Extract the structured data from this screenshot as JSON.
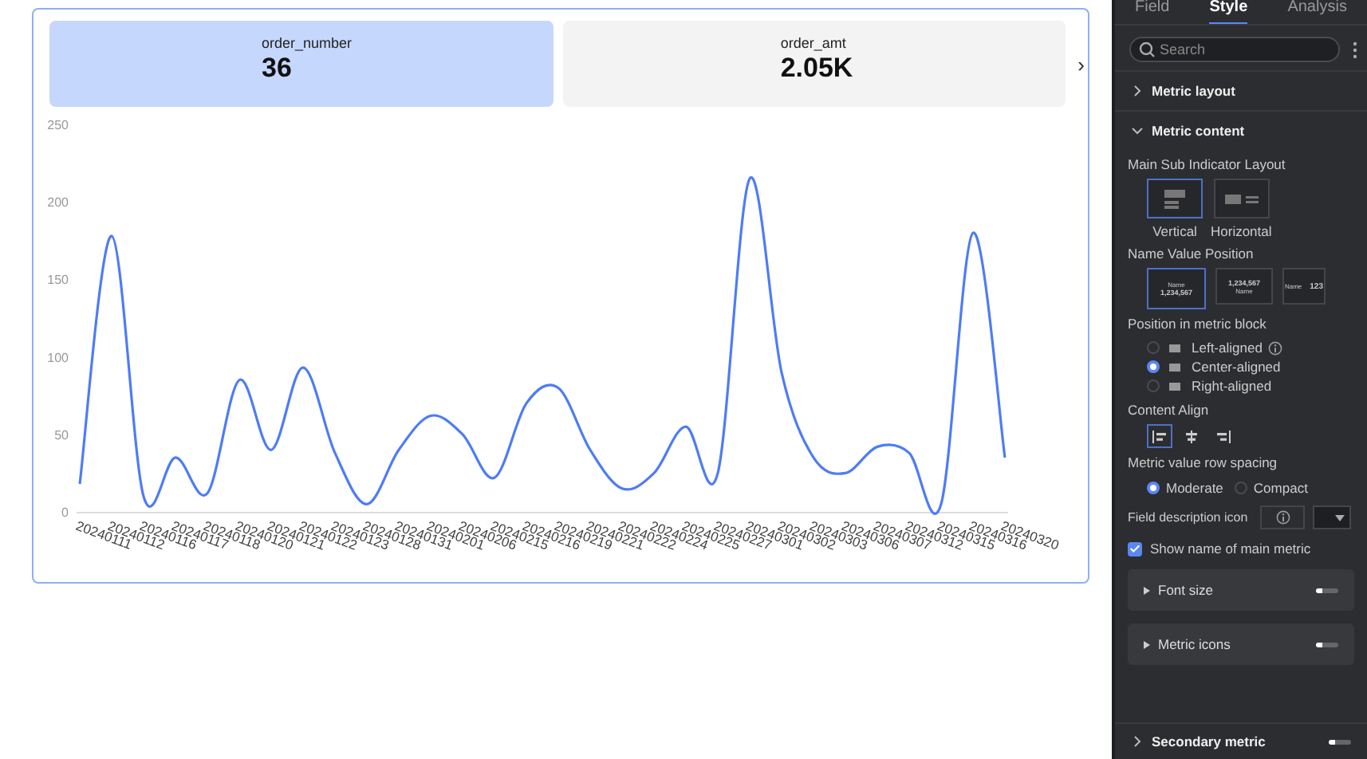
{
  "metric_cards": [
    {
      "name": "order_number",
      "value": "36",
      "selected": true
    },
    {
      "name": "order_amt",
      "value": "2.05K",
      "selected": false
    }
  ],
  "next_arrow": "›",
  "chart_data": {
    "type": "line",
    "categories": [
      "20240111",
      "20240112",
      "20240116",
      "20240117",
      "20240118",
      "20240120",
      "20240121",
      "20240122",
      "20240123",
      "20240128",
      "20240131",
      "20240201",
      "20240206",
      "20240215",
      "20240216",
      "20240219",
      "20240221",
      "20240222",
      "20240224",
      "20240225",
      "20240227",
      "20240301",
      "20240302",
      "20240303",
      "20240306",
      "20240307",
      "20240312",
      "20240315",
      "20240316",
      "20240320"
    ],
    "values": [
      18,
      178,
      10,
      35,
      12,
      85,
      40,
      93,
      38,
      5,
      40,
      62,
      50,
      22,
      70,
      80,
      40,
      15,
      25,
      55,
      25,
      215,
      90,
      35,
      25,
      42,
      38,
      5,
      180,
      35
    ],
    "ylim": [
      0,
      250
    ],
    "yticks": [
      0,
      50,
      100,
      150,
      200,
      250
    ]
  },
  "panel": {
    "tabs": [
      {
        "label": "Field",
        "selected": false
      },
      {
        "label": "Style",
        "selected": true
      },
      {
        "label": "Analysis",
        "selected": false
      }
    ],
    "search": {
      "placeholder": "Search"
    },
    "metric_layout": {
      "title": "Metric layout",
      "expanded": false
    },
    "metric_content": {
      "title": "Metric content",
      "expanded": true,
      "layout": {
        "label": "Main Sub Indicator Layout",
        "options": [
          {
            "kind": "vertical",
            "label": "Vertical",
            "selected": true
          },
          {
            "kind": "horizontal",
            "label": "Horizontal",
            "selected": false
          }
        ]
      },
      "name_value": {
        "label": "Name Value Position",
        "options": [
          {
            "kind": "name-top",
            "name": "Name",
            "value": "1,234,567",
            "selected": true
          },
          {
            "kind": "name-bottom",
            "name": "Name",
            "value": "1,234,567",
            "selected": false
          },
          {
            "kind": "name-left",
            "name": "Name",
            "value": "123",
            "selected": false
          }
        ]
      },
      "position": {
        "label": "Position in metric block",
        "options": [
          {
            "label": "Left-aligned",
            "info": true,
            "selected": false
          },
          {
            "label": "Center-aligned",
            "info": false,
            "selected": true
          },
          {
            "label": "Right-aligned",
            "info": false,
            "selected": false
          }
        ]
      },
      "content_align": {
        "label": "Content Align",
        "options": [
          {
            "kind": "left",
            "selected": true
          },
          {
            "kind": "center",
            "selected": false
          },
          {
            "kind": "right",
            "selected": false
          }
        ]
      },
      "row_spacing": {
        "label": "Metric value row spacing",
        "options": [
          {
            "label": "Moderate",
            "selected": true
          },
          {
            "label": "Compact",
            "selected": false
          }
        ]
      },
      "description_icon": {
        "label": "Field description icon"
      },
      "show_name": {
        "label": "Show name of main metric",
        "checked": true
      },
      "subsections": [
        {
          "title": "Font size",
          "on": false
        },
        {
          "title": "Metric icons",
          "on": false
        }
      ]
    },
    "secondary_metric": {
      "title": "Secondary metric",
      "on": false
    }
  }
}
